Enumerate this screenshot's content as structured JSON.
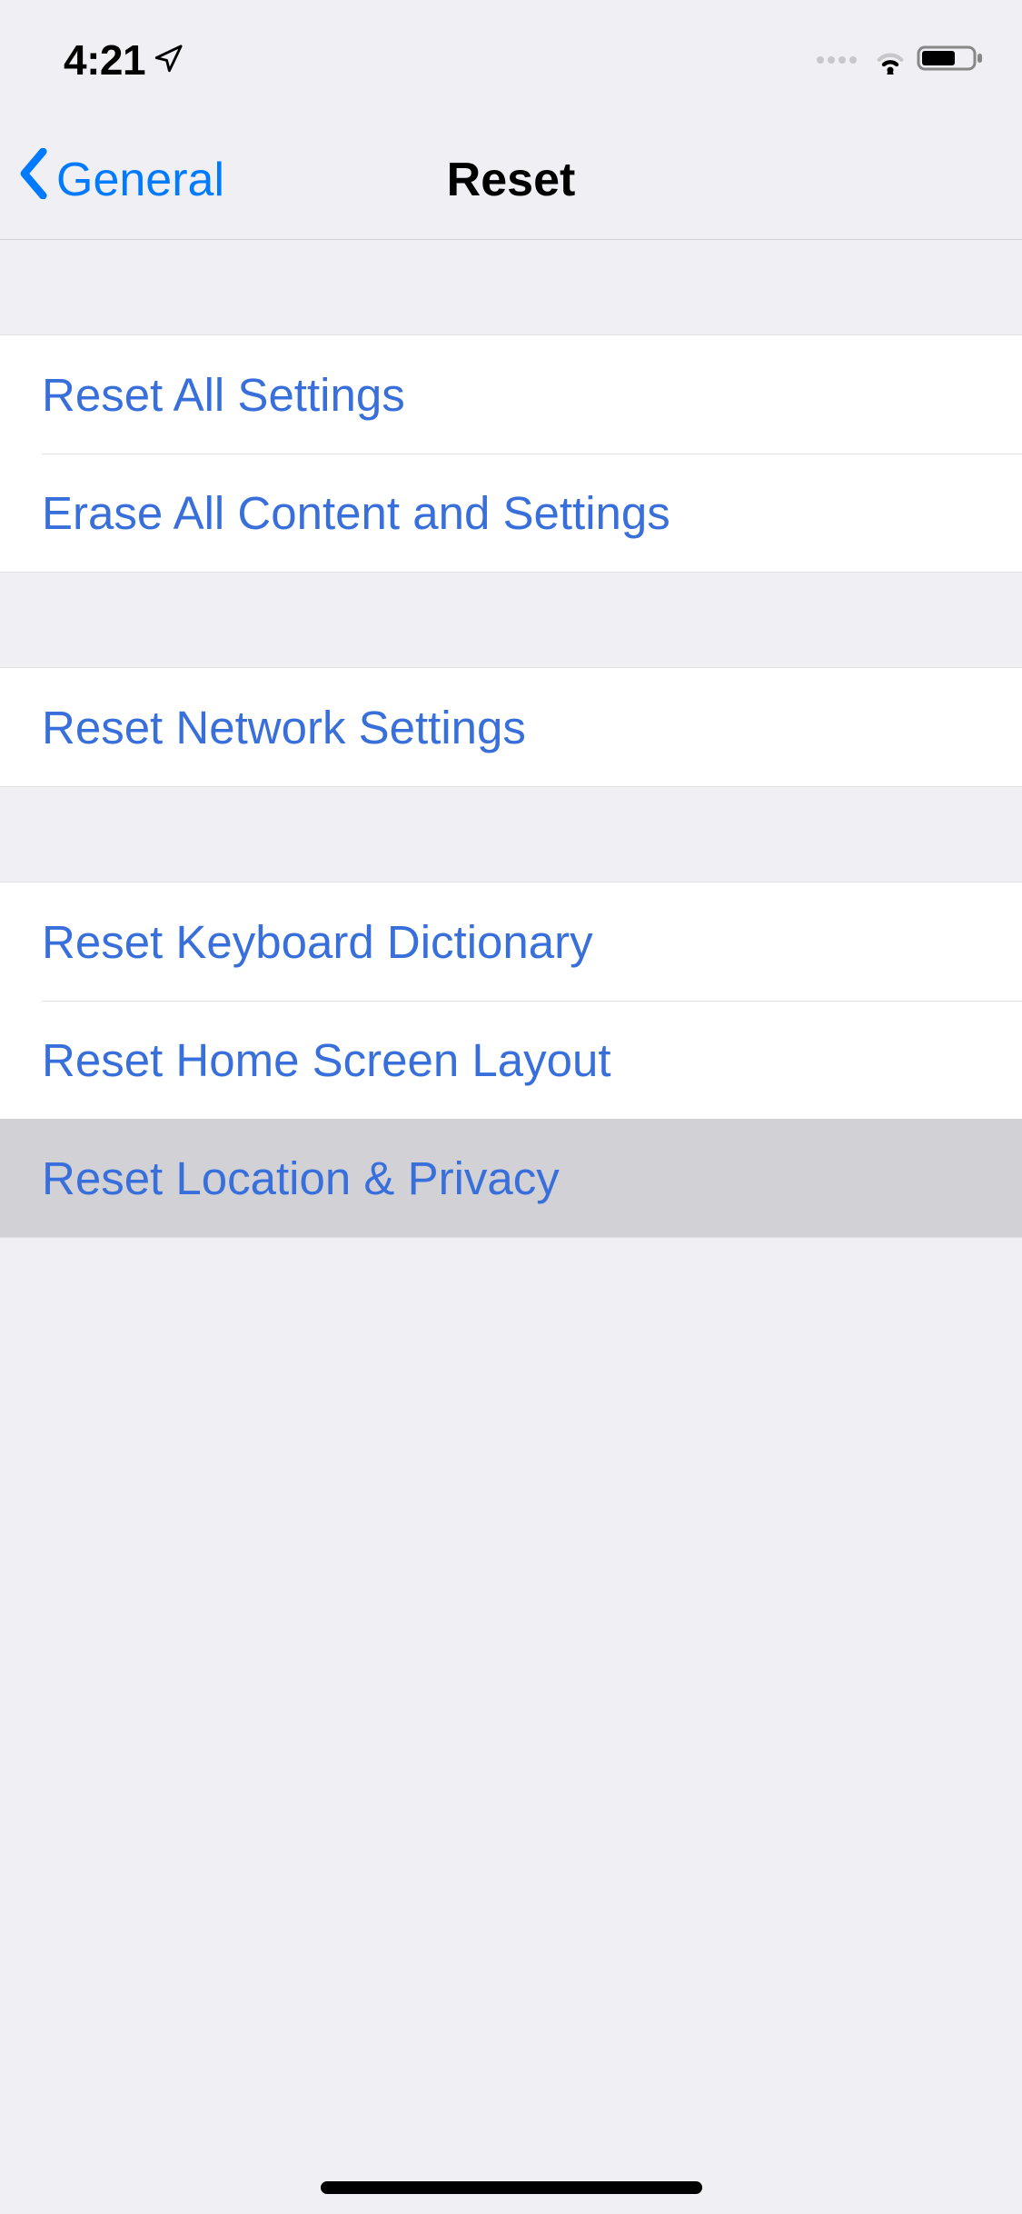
{
  "status": {
    "time": "4:21"
  },
  "nav": {
    "back_label": "General",
    "title": "Reset"
  },
  "sections": [
    {
      "rows": [
        {
          "label": "Reset All Settings"
        },
        {
          "label": "Erase All Content and Settings"
        }
      ]
    },
    {
      "rows": [
        {
          "label": "Reset Network Settings"
        }
      ]
    },
    {
      "rows": [
        {
          "label": "Reset Keyboard Dictionary"
        },
        {
          "label": "Reset Home Screen Layout"
        },
        {
          "label": "Reset Location & Privacy"
        }
      ]
    }
  ]
}
